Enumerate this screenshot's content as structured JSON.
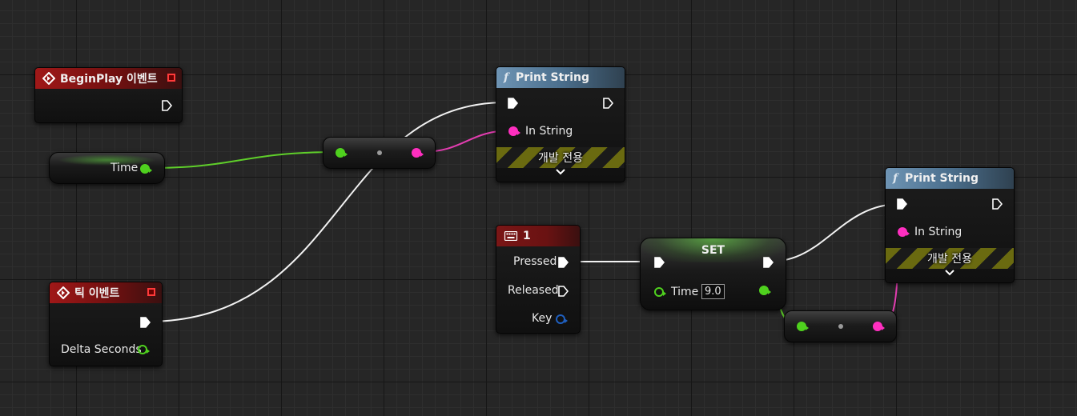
{
  "colors": {
    "exec": "#ffffff",
    "float": "#7ee53a",
    "string": "#ff3ec4",
    "struct": "#1f5fbf"
  },
  "nodes": {
    "begin_play": {
      "title": "BeginPlay 이벤트",
      "icon": "event-diamond-icon"
    },
    "tick": {
      "title": "틱 이벤트",
      "icon": "event-diamond-icon",
      "delta_label": "Delta Seconds"
    },
    "time_getter": {
      "label": "Time"
    },
    "print_string_1": {
      "title": "Print String",
      "icon": "function-icon",
      "in_string_label": "In String",
      "dev_only_label": "개발 전용",
      "expand_icon": "chevron-down-icon"
    },
    "key_1": {
      "title": "1",
      "icon": "keyboard-icon",
      "pressed_label": "Pressed",
      "released_label": "Released",
      "key_label": "Key"
    },
    "set_node": {
      "title": "SET",
      "time_label": "Time",
      "time_value": "9.0"
    },
    "print_string_2": {
      "title": "Print String",
      "icon": "function-icon",
      "in_string_label": "In String",
      "dev_only_label": "개발 전용",
      "expand_icon": "chevron-down-icon"
    }
  }
}
